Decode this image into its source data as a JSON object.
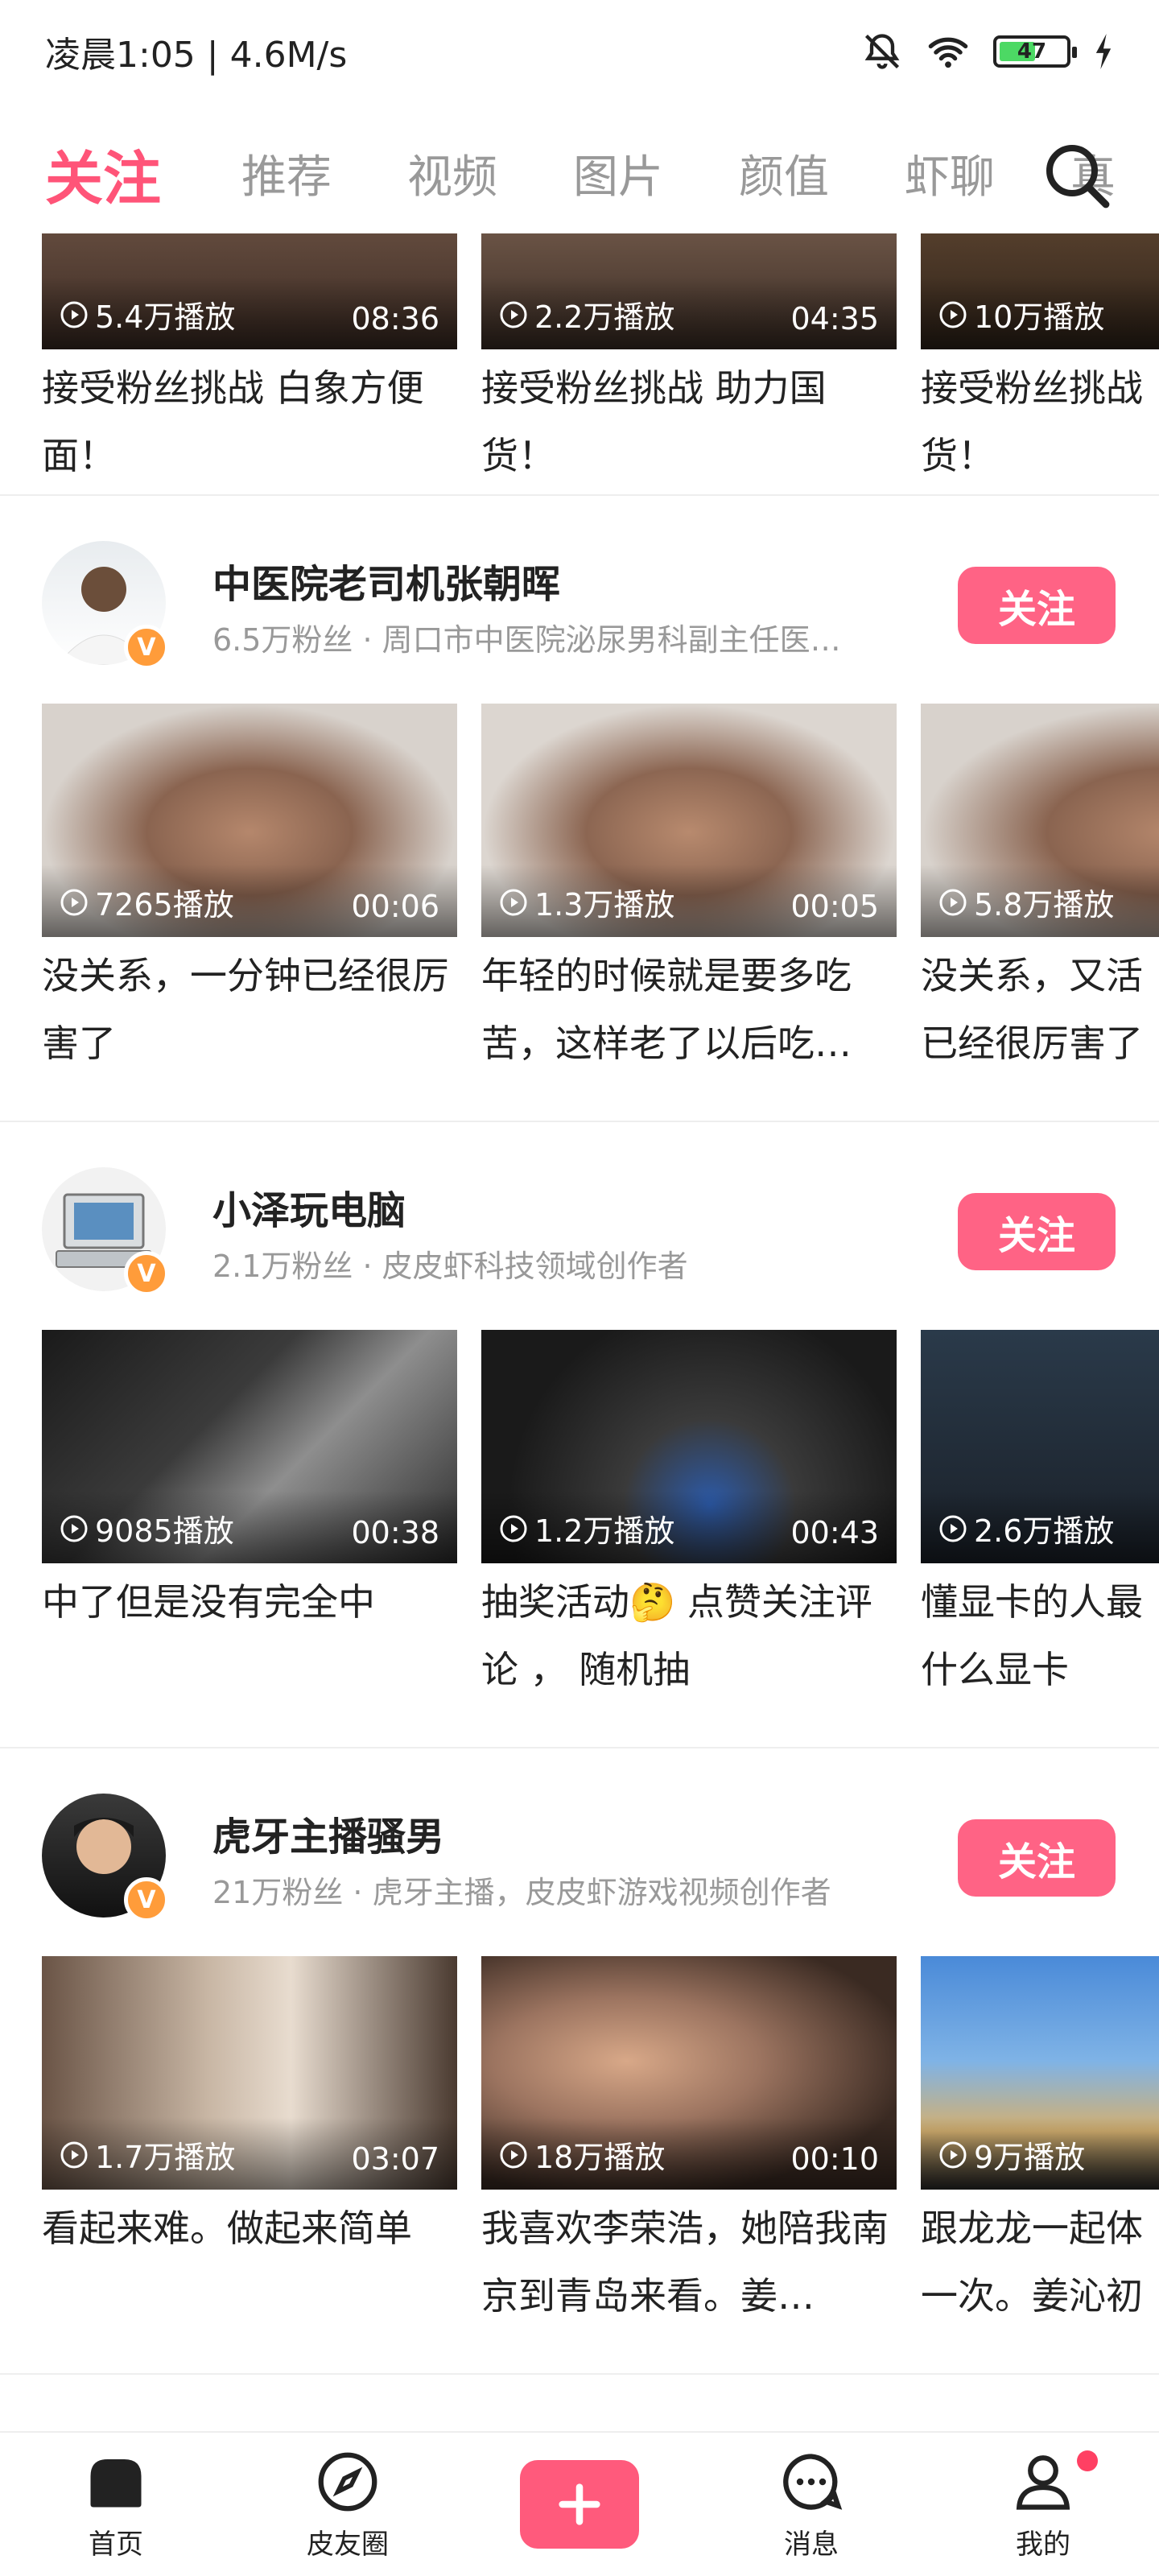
{
  "status": {
    "time": "凌晨1:05 | 4.6M/s",
    "battery": "47"
  },
  "tabs": [
    "关注",
    "推荐",
    "视频",
    "图片",
    "颜值",
    "虾聊",
    "真"
  ],
  "top_row": [
    {
      "plays": "5.4万播放",
      "duration": "08:36",
      "title": "接受粉丝挑战 白象方便面！"
    },
    {
      "plays": "2.2万播放",
      "duration": "04:35",
      "title": "接受粉丝挑战 助力国货！"
    },
    {
      "plays": "10万播放",
      "duration": "",
      "title": "接受粉丝挑战 货！"
    }
  ],
  "creators": [
    {
      "name": "中医院老司机张朝晖",
      "desc": "6.5万粉丝 · 周口市中医院泌尿男科副主任医…",
      "follow": "关注",
      "videos": [
        {
          "plays": "7265播放",
          "duration": "00:06",
          "title": "没关系，一分钟已经很厉害了"
        },
        {
          "plays": "1.3万播放",
          "duration": "00:05",
          "title": "年轻的时候就是要多吃苦，这样老了以后吃…"
        },
        {
          "plays": "5.8万播放",
          "duration": "",
          "title": "没关系，又活 已经很厉害了"
        }
      ]
    },
    {
      "name": "小泽玩电脑",
      "desc": "2.1万粉丝 · 皮皮虾科技领域创作者",
      "follow": "关注",
      "videos": [
        {
          "plays": "9085播放",
          "duration": "00:38",
          "title": "中了但是没有完全中"
        },
        {
          "plays": "1.2万播放",
          "duration": "00:43",
          "title": "抽奖活动🤔 点赞关注评论 ， 随机抽"
        },
        {
          "plays": "2.6万播放",
          "duration": "",
          "title": "懂显卡的人最 什么显卡"
        }
      ]
    },
    {
      "name": "虎牙主播骚男",
      "desc": "21万粉丝 · 虎牙主播，皮皮虾游戏视频创作者",
      "follow": "关注",
      "videos": [
        {
          "plays": "1.7万播放",
          "duration": "03:07",
          "title": "看起来难。做起来简单"
        },
        {
          "plays": "18万播放",
          "duration": "00:10",
          "title": "我喜欢李荣浩，她陪我南京到青岛来看。姜…"
        },
        {
          "plays": "9万播放",
          "duration": "",
          "title": "跟龙龙一起体 一次。姜沁初"
        }
      ]
    }
  ],
  "nav": [
    {
      "label": "首页",
      "icon": "home-icon"
    },
    {
      "label": "皮友圈",
      "icon": "compass-icon"
    },
    {
      "label": "",
      "icon": "plus-icon"
    },
    {
      "label": "消息",
      "icon": "message-icon"
    },
    {
      "label": "我的",
      "icon": "user-icon"
    }
  ],
  "colors": {
    "accent": "#ff5478",
    "follow_button": "#ff6385",
    "badge": "#ff9c3a"
  }
}
